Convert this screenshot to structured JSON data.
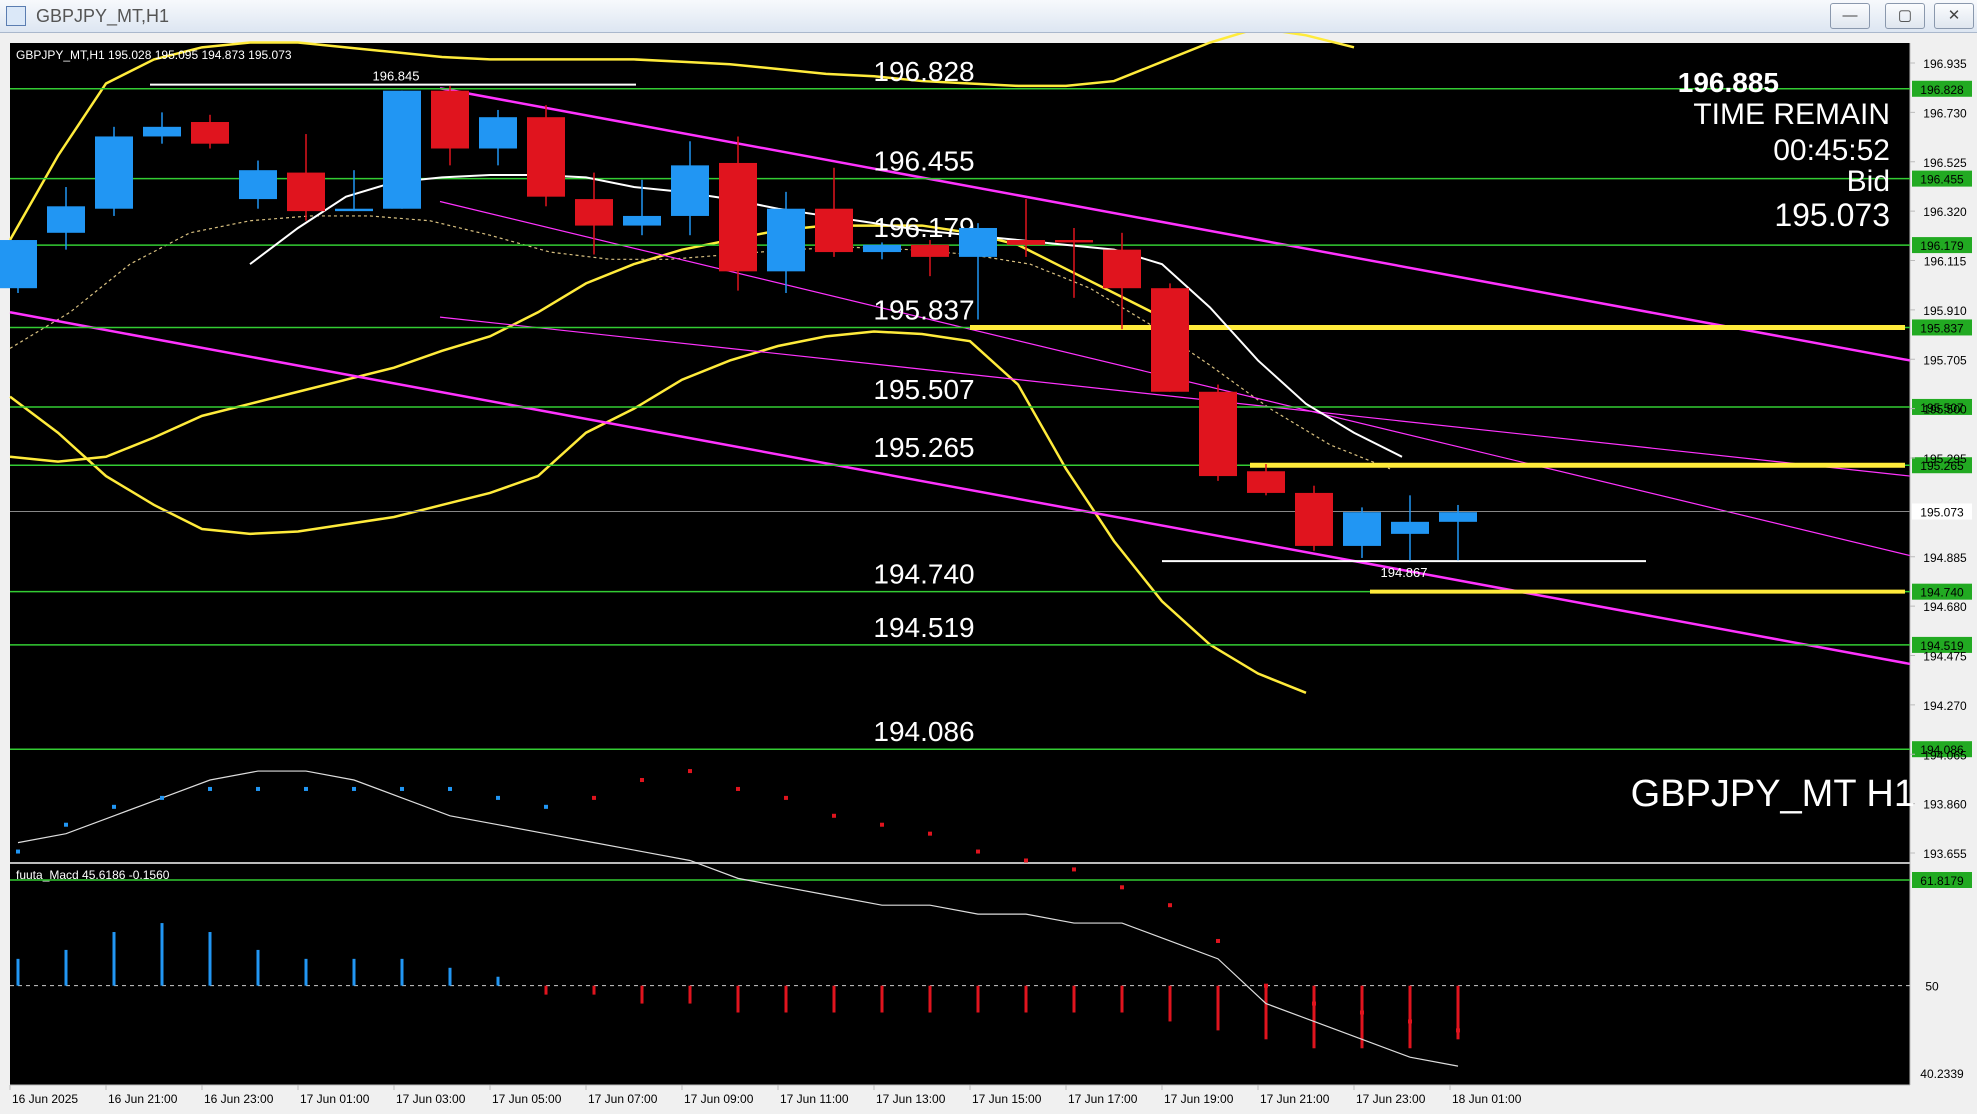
{
  "window": {
    "title": "GBPJPY_MT,H1",
    "min_label": "—",
    "max_label": "▢",
    "close_label": "✕"
  },
  "chart_data": {
    "type": "candlestick",
    "symbol": "GBPJPY_MT,H1",
    "ohlc_header": "GBPJPY_MT,H1  195.028 195.095 194.873 195.073",
    "watermark": "GBPJPY_MT H1",
    "info_panel": {
      "price": "196.885",
      "time_remain_label": "TIME REMAIN",
      "time_remain": "00:45:52",
      "bid_label": "Bid",
      "bid": "195.073"
    },
    "price_axis_ticks": [
      "196.935",
      "196.730",
      "196.525",
      "196.320",
      "196.115",
      "195.910",
      "195.705",
      "195.500",
      "195.295",
      "194.885",
      "194.680",
      "194.475",
      "194.270",
      "194.065",
      "193.860",
      "193.655"
    ],
    "current_price_tag": "195.073",
    "levels": [
      {
        "price": 196.828,
        "label": "196.828"
      },
      {
        "price": 196.455,
        "label": "196.455"
      },
      {
        "price": 196.179,
        "label": "196.179"
      },
      {
        "price": 195.837,
        "label": "195.837"
      },
      {
        "price": 195.507,
        "label": "195.507"
      },
      {
        "price": 195.265,
        "label": "195.265"
      },
      {
        "price": 194.74,
        "label": "194.740"
      },
      {
        "price": 194.519,
        "label": "194.519"
      },
      {
        "price": 194.086,
        "label": "194.086"
      }
    ],
    "marked_high": {
      "label": "196.845",
      "price": 196.845
    },
    "marked_low": {
      "label": "194.867",
      "price": 194.867
    },
    "candles": [
      {
        "o": 196.0,
        "h": 196.2,
        "l": 195.98,
        "c": 196.2
      },
      {
        "o": 196.23,
        "h": 196.42,
        "l": 196.16,
        "c": 196.34
      },
      {
        "o": 196.33,
        "h": 196.67,
        "l": 196.3,
        "c": 196.63
      },
      {
        "o": 196.63,
        "h": 196.73,
        "l": 196.6,
        "c": 196.67
      },
      {
        "o": 196.69,
        "h": 196.72,
        "l": 196.58,
        "c": 196.6
      },
      {
        "o": 196.37,
        "h": 196.53,
        "l": 196.33,
        "c": 196.49
      },
      {
        "o": 196.48,
        "h": 196.64,
        "l": 196.28,
        "c": 196.32
      },
      {
        "o": 196.32,
        "h": 196.49,
        "l": 196.32,
        "c": 196.33
      },
      {
        "o": 196.33,
        "h": 196.82,
        "l": 196.33,
        "c": 196.82
      },
      {
        "o": 196.82,
        "h": 196.84,
        "l": 196.51,
        "c": 196.58
      },
      {
        "o": 196.58,
        "h": 196.74,
        "l": 196.51,
        "c": 196.71
      },
      {
        "o": 196.71,
        "h": 196.76,
        "l": 196.34,
        "c": 196.38
      },
      {
        "o": 196.37,
        "h": 196.48,
        "l": 196.14,
        "c": 196.26
      },
      {
        "o": 196.26,
        "h": 196.45,
        "l": 196.22,
        "c": 196.3
      },
      {
        "o": 196.3,
        "h": 196.61,
        "l": 196.22,
        "c": 196.51
      },
      {
        "o": 196.52,
        "h": 196.63,
        "l": 195.99,
        "c": 196.07
      },
      {
        "o": 196.07,
        "h": 196.4,
        "l": 195.98,
        "c": 196.33
      },
      {
        "o": 196.33,
        "h": 196.5,
        "l": 196.13,
        "c": 196.15
      },
      {
        "o": 196.15,
        "h": 196.19,
        "l": 196.12,
        "c": 196.18
      },
      {
        "o": 196.18,
        "h": 196.2,
        "l": 196.05,
        "c": 196.13
      },
      {
        "o": 196.13,
        "h": 196.27,
        "l": 195.87,
        "c": 196.25
      },
      {
        "o": 196.2,
        "h": 196.37,
        "l": 196.13,
        "c": 196.18
      },
      {
        "o": 196.2,
        "h": 196.25,
        "l": 195.96,
        "c": 196.19
      },
      {
        "o": 196.16,
        "h": 196.23,
        "l": 195.83,
        "c": 196.0
      },
      {
        "o": 196.0,
        "h": 196.02,
        "l": 195.57,
        "c": 195.57
      },
      {
        "o": 195.57,
        "h": 195.6,
        "l": 195.2,
        "c": 195.22
      },
      {
        "o": 195.24,
        "h": 195.27,
        "l": 195.14,
        "c": 195.15
      },
      {
        "o": 195.15,
        "h": 195.18,
        "l": 194.91,
        "c": 194.93
      },
      {
        "o": 194.93,
        "h": 195.09,
        "l": 194.88,
        "c": 195.07
      },
      {
        "o": 194.98,
        "h": 195.14,
        "l": 194.87,
        "c": 195.03
      },
      {
        "o": 195.03,
        "h": 195.1,
        "l": 194.87,
        "c": 195.07
      }
    ],
    "time_labels": [
      "16 Jun 2025",
      "16 Jun 21:00",
      "16 Jun 23:00",
      "17 Jun 01:00",
      "17 Jun 03:00",
      "17 Jun 05:00",
      "17 Jun 07:00",
      "17 Jun 09:00",
      "17 Jun 11:00",
      "17 Jun 13:00",
      "17 Jun 15:00",
      "17 Jun 17:00",
      "17 Jun 19:00",
      "17 Jun 21:00",
      "17 Jun 23:00",
      "18 Jun 01:00"
    ],
    "indicator": {
      "name": "fuuta_Macd 45.6186 -0.1560",
      "axis_labels": [
        "61.8179",
        "50",
        "40.2339"
      ],
      "line": [
        66,
        67,
        69,
        71,
        73,
        74,
        74,
        73,
        71,
        69,
        68,
        67,
        66,
        65,
        64,
        62,
        61,
        60,
        59,
        59,
        58,
        58,
        57,
        57,
        55,
        53,
        48,
        46,
        44,
        42,
        41
      ],
      "histogram": [
        3,
        4,
        6,
        7,
        6,
        4,
        3,
        3,
        3,
        2,
        1,
        -1,
        -1,
        -2,
        -2,
        -3,
        -3,
        -3,
        -3,
        -3,
        -3,
        -3,
        -3,
        -3,
        -4,
        -5,
        -6,
        -7,
        -7,
        -7,
        -6
      ],
      "dots": [
        65,
        68,
        70,
        71,
        72,
        72,
        72,
        72,
        72,
        72,
        71,
        70,
        71,
        73,
        74,
        72,
        71,
        69,
        68,
        67,
        65,
        64,
        63,
        61,
        59,
        55,
        50,
        48,
        47,
        46,
        45
      ]
    }
  }
}
